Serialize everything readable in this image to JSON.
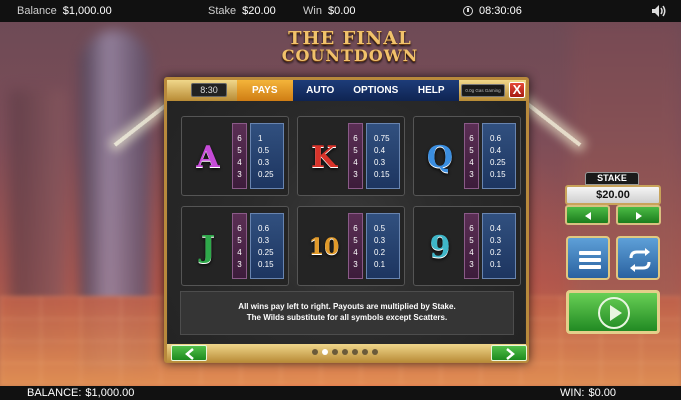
{
  "top_bar": {
    "balance_label": "Balance",
    "balance_value": "$1,000.00",
    "stake_label": "Stake",
    "stake_value": "$20.00",
    "win_label": "Win",
    "win_value": "$0.00",
    "clock": "08:30:06",
    "sound_icon": "speaker-icon"
  },
  "logo": {
    "line1": "THE FINAL",
    "line2": "COUNTDOWN"
  },
  "paytable": {
    "time": "8:30",
    "tabs": [
      {
        "label": "PAYS",
        "active": true
      },
      {
        "label": "AUTO",
        "active": false
      },
      {
        "label": "OPTIONS",
        "active": false
      },
      {
        "label": "HELP",
        "active": false
      }
    ],
    "game_code": "0.0g Gas Gaming",
    "close_label": "X",
    "symbols": [
      {
        "symbol": "A",
        "color": "#c64bd8",
        "multipliers": [
          "6",
          "5",
          "4",
          "3"
        ],
        "pays": [
          "1",
          "0.5",
          "0.3",
          "0.25"
        ]
      },
      {
        "symbol": "K",
        "color": "#d8332a",
        "multipliers": [
          "6",
          "5",
          "4",
          "3"
        ],
        "pays": [
          "0.75",
          "0.4",
          "0.3",
          "0.15"
        ]
      },
      {
        "symbol": "Q",
        "color": "#3b8ee0",
        "multipliers": [
          "6",
          "5",
          "4",
          "3"
        ],
        "pays": [
          "0.6",
          "0.4",
          "0.25",
          "0.15"
        ]
      },
      {
        "symbol": "J",
        "color": "#2ea84a",
        "multipliers": [
          "6",
          "5",
          "4",
          "3"
        ],
        "pays": [
          "0.6",
          "0.3",
          "0.25",
          "0.15"
        ]
      },
      {
        "symbol": "10",
        "color": "#e19a2a",
        "multipliers": [
          "6",
          "5",
          "4",
          "3"
        ],
        "pays": [
          "0.5",
          "0.3",
          "0.2",
          "0.1"
        ]
      },
      {
        "symbol": "9",
        "color": "#3fb6c8",
        "multipliers": [
          "6",
          "5",
          "4",
          "3"
        ],
        "pays": [
          "0.4",
          "0.3",
          "0.2",
          "0.1"
        ]
      }
    ],
    "info_line1": "All wins pay left to right. Payouts are multiplied by Stake.",
    "info_line2": "The Wilds substitute for all symbols except Scatters.",
    "page_count": 7,
    "active_page": 1
  },
  "controls": {
    "stake_title": "STAKE",
    "stake_value": "$20.00",
    "icons": {
      "stake_dec": "left-arrow-icon",
      "stake_inc": "right-arrow-icon",
      "menu": "menu-icon",
      "autoplay": "autoplay-icon",
      "spin": "play-icon"
    }
  },
  "bottom_bar": {
    "balance_label": "BALANCE:",
    "balance_value": "$1,000.00",
    "win_label": "WIN:",
    "win_value": "$0.00"
  }
}
